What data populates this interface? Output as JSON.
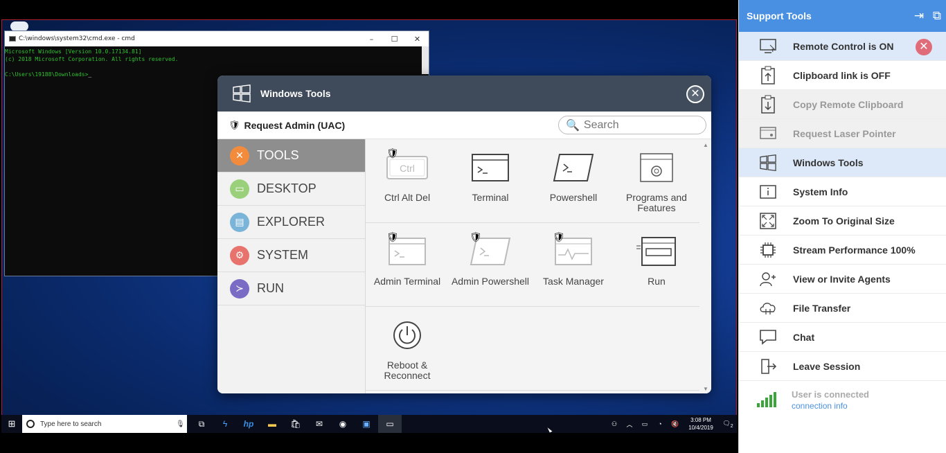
{
  "cmd": {
    "title": "C:\\windows\\system32\\cmd.exe - cmd",
    "lines": [
      "Microsoft Windows [Version 10.0.17134.81]",
      "(c) 2018 Microsoft Corporation. All rights reserved.",
      "",
      "C:\\Users\\19188\\Downloads>"
    ],
    "controls": [
      "–",
      "☐",
      "✕"
    ]
  },
  "taskbar": {
    "search_placeholder": "Type here to search",
    "clock_time": "3:08 PM",
    "clock_date": "10/4/2019",
    "notification_count": "2"
  },
  "windows_tools": {
    "title": "Windows Tools",
    "uac_label": "Request Admin (UAC)",
    "search_placeholder": "Search",
    "categories": [
      {
        "label": "TOOLS",
        "color": "#f28c3c",
        "glyph": "✕"
      },
      {
        "label": "DESKTOP",
        "color": "#9ad07a",
        "glyph": "▭"
      },
      {
        "label": "EXPLORER",
        "color": "#7ab4d8",
        "glyph": "▤"
      },
      {
        "label": "SYSTEM",
        "color": "#e8726c",
        "glyph": "⚙"
      },
      {
        "label": "RUN",
        "color": "#7a6cc4",
        "glyph": "≻"
      }
    ],
    "tools": [
      {
        "label": "Ctrl Alt Del",
        "shield": true
      },
      {
        "label": "Terminal",
        "shield": false
      },
      {
        "label": "Powershell",
        "shield": false
      },
      {
        "label": "Programs and Features",
        "shield": false
      },
      {
        "label": "Admin Terminal",
        "shield": true
      },
      {
        "label": "Admin Powershell",
        "shield": true
      },
      {
        "label": "Task Manager",
        "shield": true
      },
      {
        "label": "Run",
        "shield": false
      },
      {
        "label": "Reboot & Reconnect",
        "shield": false
      }
    ],
    "ctrl_key_text": "Ctrl"
  },
  "support_tools": {
    "title": "Support Tools",
    "items": [
      {
        "label": "Remote Control is ON",
        "state": "selected"
      },
      {
        "label": "Clipboard link is OFF",
        "state": "normal"
      },
      {
        "label": "Copy Remote Clipboard",
        "state": "disabled"
      },
      {
        "label": "Request Laser Pointer",
        "state": "disabled"
      },
      {
        "label": "Windows Tools",
        "state": "selected"
      },
      {
        "label": "System Info",
        "state": "normal"
      },
      {
        "label": "Zoom To Original Size",
        "state": "normal"
      },
      {
        "label": "Stream Performance 100%",
        "state": "normal"
      },
      {
        "label": "View or Invite Agents",
        "state": "normal"
      },
      {
        "label": "File Transfer",
        "state": "normal"
      },
      {
        "label": "Chat",
        "state": "normal"
      },
      {
        "label": "Leave Session",
        "state": "normal"
      }
    ],
    "status": "User is connected",
    "connection_link": "connection info",
    "accent_color": "#4a90e2",
    "signal_color": "#3aa63a"
  }
}
